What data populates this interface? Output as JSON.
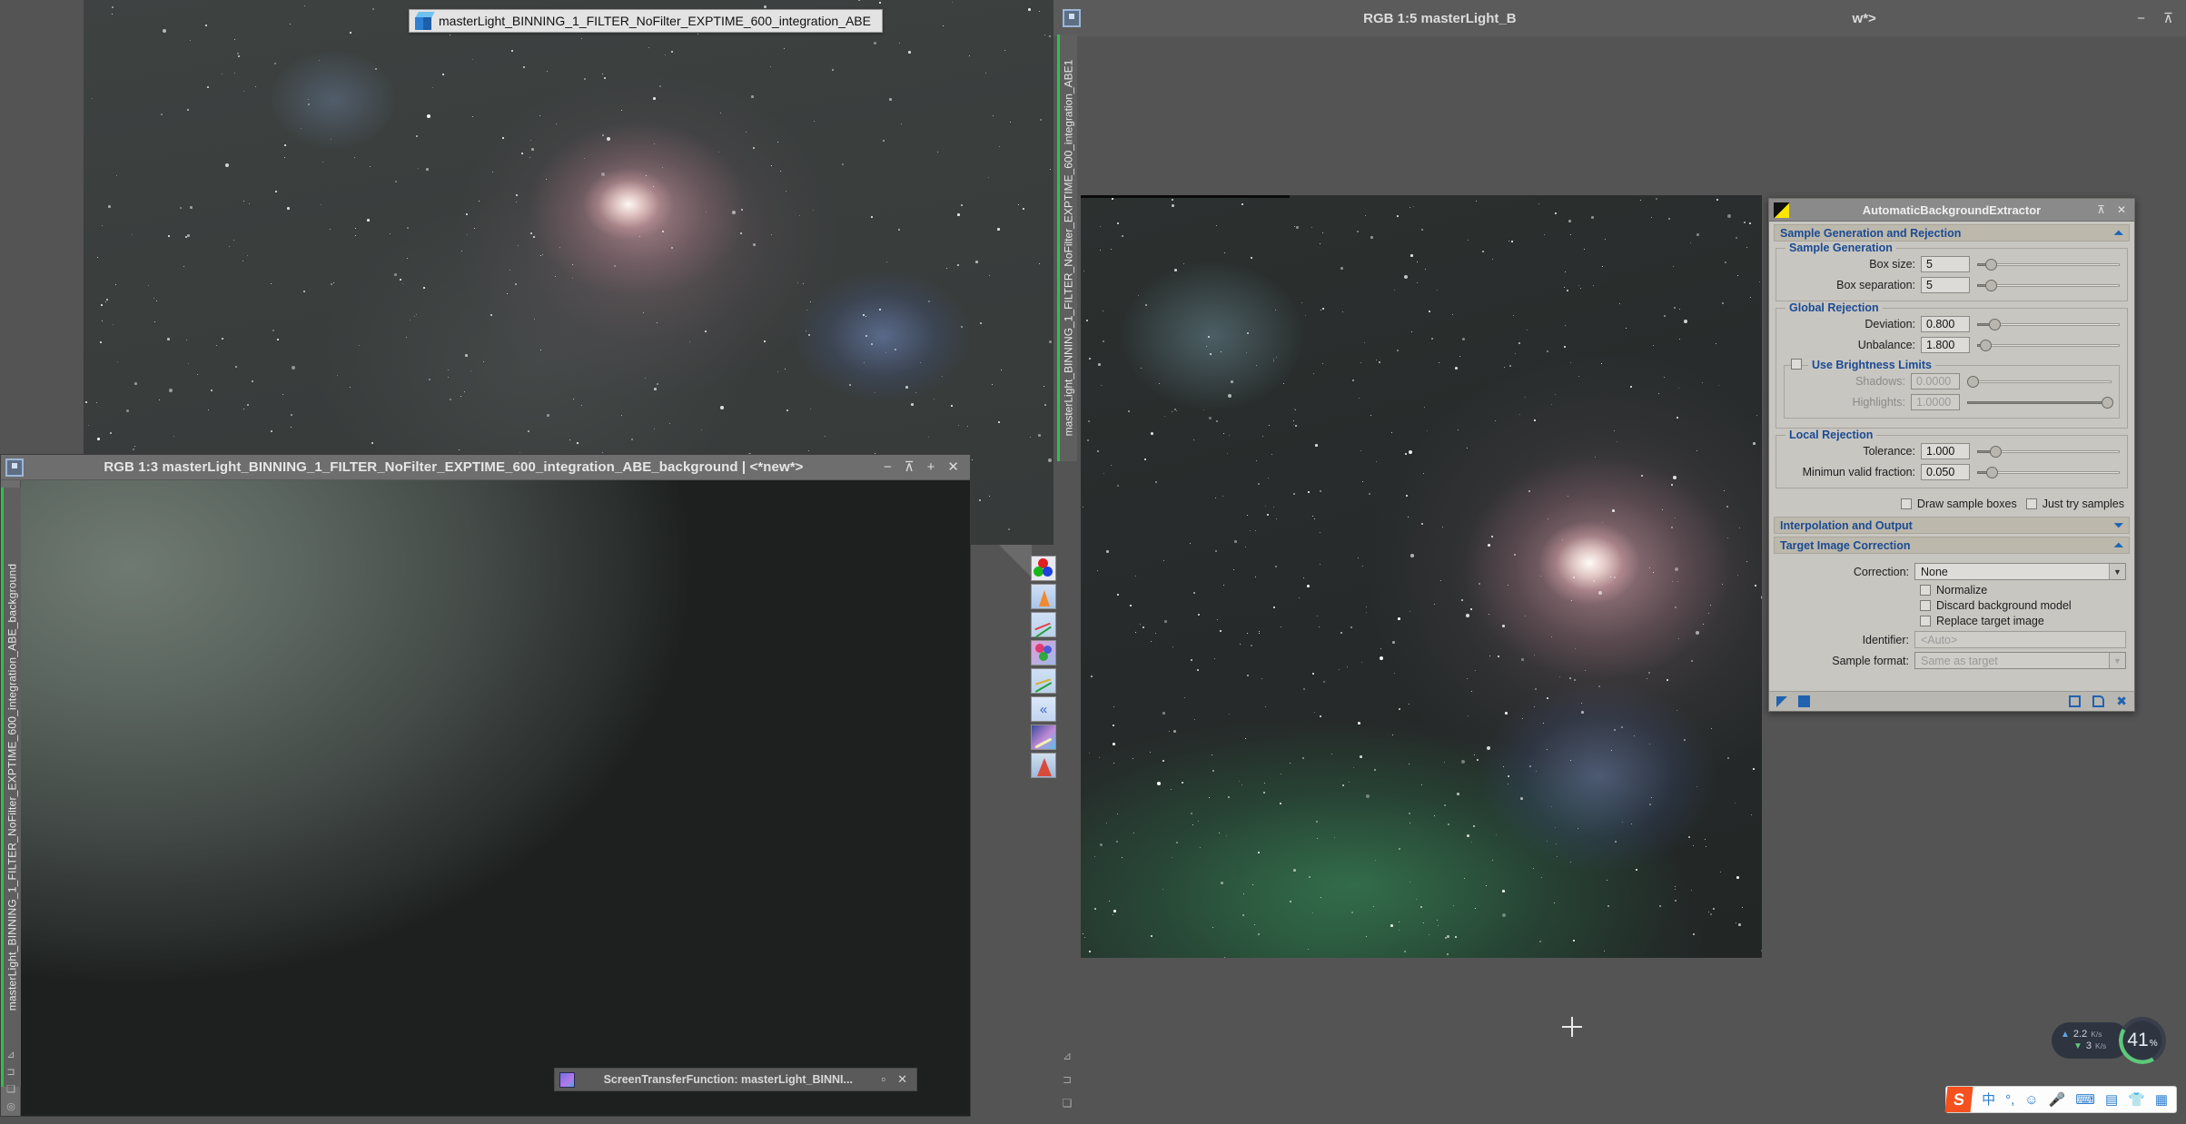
{
  "windows": {
    "back_image": {
      "name": "masterLight image preview"
    },
    "abe_background_window": {
      "title": "RGB 1:3 masterLight_BINNING_1_FILTER_NoFilter_EXPTIME_600_integration_ABE_background | <*new*>",
      "vertical_tab": "masterLight_BINNING_1_FILTER_NoFilter_EXPTIME_600_integration_ABE_background",
      "buttons": {
        "minimize": "−",
        "restore": "⊼",
        "maximize": "+",
        "close": "✕"
      },
      "dock_icons": [
        "zoom-fit-icon",
        "fit-window-icon",
        "duplicate-icon",
        "target-icon"
      ]
    },
    "abe1_window": {
      "title": "RGB 1:5 masterLight_B",
      "title_tail": "w*>",
      "vertical_tab": "masterLight_BINNING_1_FILTER_NoFilter_EXPTIME_600_integration_ABE1",
      "buttons": {
        "minimize": "−",
        "restore": "⊼"
      },
      "dock_icons": [
        "zoom-fit-icon",
        "fit-window-icon",
        "duplicate-icon"
      ]
    }
  },
  "tooltip": {
    "text": "masterLight_BINNING_1_FILTER_NoFilter_EXPTIME_600_integration_ABE",
    "icon": "image-cube-icon"
  },
  "icon_toolbar": {
    "items": [
      {
        "name": "rgb-channels-icon"
      },
      {
        "name": "histogram-transformation-icon"
      },
      {
        "name": "curves-transformation-icon"
      },
      {
        "name": "color-saturation-icon"
      },
      {
        "name": "curves-graph-icon"
      },
      {
        "name": "rewind-icon"
      },
      {
        "name": "screen-transfer-function-icon"
      },
      {
        "name": "wavelet-icon"
      }
    ]
  },
  "abe_dialog": {
    "title": "AutomaticBackgroundExtractor",
    "logo": "pixinsight-process-icon",
    "titlebar_buttons": {
      "rollup": "⊼",
      "close": "✕"
    },
    "sections": [
      {
        "id": "sample_generation_and_rejection",
        "label": "Sample Generation and Rejection",
        "arrow": "collapse",
        "arrow_glyph": "⏶"
      },
      {
        "id": "interpolation_and_output",
        "label": "Interpolation and Output",
        "arrow": "expand",
        "arrow_glyph": "⏷"
      },
      {
        "id": "target_image_correction",
        "label": "Target Image Correction",
        "arrow": "collapse",
        "arrow_glyph": "⏶"
      }
    ],
    "groups": {
      "sample_generation": {
        "label": "Sample Generation",
        "fields": [
          {
            "label": "Box size:",
            "value": "5",
            "slider_pct": 4
          },
          {
            "label": "Box separation:",
            "value": "5",
            "slider_pct": 4
          }
        ]
      },
      "global_rejection": {
        "label": "Global Rejection",
        "fields": [
          {
            "label": "Deviation:",
            "value": "0.800",
            "slider_pct": 7
          },
          {
            "label": "Unbalance:",
            "value": "1.800",
            "slider_pct": 2
          }
        ]
      },
      "use_brightness_limits": {
        "label": "Use Brightness Limits",
        "checked": false,
        "fields": [
          {
            "label": "Shadows:",
            "value": "0.0000",
            "slider_pct": 0,
            "disabled": true
          },
          {
            "label": "Highlights:",
            "value": "1.0000",
            "slider_pct": 100,
            "disabled": true
          }
        ]
      },
      "local_rejection": {
        "label": "Local Rejection",
        "fields": [
          {
            "label": "Tolerance:",
            "value": "1.000",
            "slider_pct": 8
          },
          {
            "label": "Minimun valid fraction:",
            "value": "0.050",
            "slider_pct": 5
          }
        ]
      }
    },
    "sample_checkboxes": [
      {
        "label": "Draw sample boxes",
        "checked": false
      },
      {
        "label": "Just try samples",
        "checked": false
      }
    ],
    "target_image_correction": {
      "correction_label": "Correction:",
      "correction_value": "None",
      "checkboxes": [
        {
          "label": "Normalize",
          "checked": false
        },
        {
          "label": "Discard background model",
          "checked": false
        },
        {
          "label": "Replace target image",
          "checked": false
        }
      ],
      "identifier_label": "Identifier:",
      "identifier_value": "<Auto>",
      "sample_format_label": "Sample format:",
      "sample_format_value": "Same as target"
    },
    "footer_buttons": [
      {
        "name": "apply-button",
        "glyph": "◤"
      },
      {
        "name": "apply-global-button",
        "glyph": "■"
      },
      {
        "name": "browse-documentation-button",
        "glyph": "▢"
      },
      {
        "name": "reset-button",
        "glyph": "🗋"
      },
      {
        "name": "close-button",
        "glyph": "✕"
      }
    ]
  },
  "stf_window": {
    "title": "ScreenTransferFunction: masterLight_BINNI...",
    "icon": "stf-icon",
    "buttons": {
      "restore": "▫",
      "close": "✕"
    }
  },
  "desktop_widgets": {
    "network": {
      "upload": "2.2",
      "upload_unit": "K/s",
      "download": "3",
      "download_unit": "K/s"
    },
    "cpu": {
      "value": "41",
      "unit": "%",
      "accent": "#5fc87a"
    },
    "ime": {
      "logo": "S",
      "items": [
        {
          "name": "chinese-mode-icon",
          "glyph": "中"
        },
        {
          "name": "punctuation-icon",
          "glyph": "°,"
        },
        {
          "name": "emoji-icon",
          "glyph": "☺"
        },
        {
          "name": "voice-input-icon",
          "glyph": "🎤"
        },
        {
          "name": "soft-keyboard-icon",
          "glyph": "⌨"
        },
        {
          "name": "user-card-icon",
          "glyph": "▤"
        },
        {
          "name": "skin-icon",
          "glyph": "👕"
        },
        {
          "name": "toolbox-icon",
          "glyph": "▦"
        }
      ]
    }
  },
  "colors": {
    "dialog_bg": "#c8c6c1",
    "section_header_text": "#1b4b93",
    "tab_accent": "#2fbf4f",
    "cpu_accent": "#5fc87a",
    "ime_accent": "#f4511e"
  }
}
